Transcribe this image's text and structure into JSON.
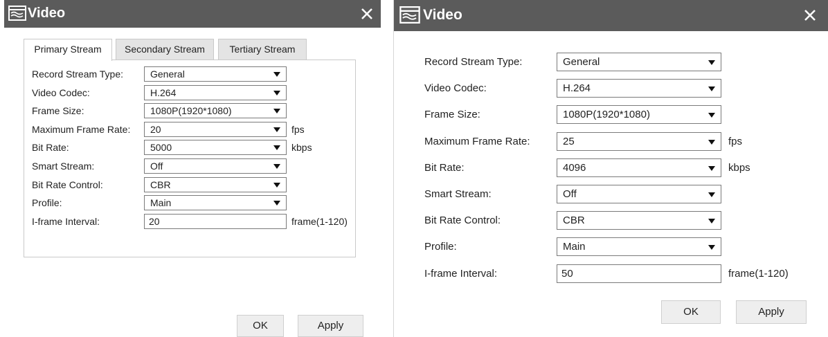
{
  "left_dialog": {
    "title": "Video",
    "tabs": [
      "Primary Stream",
      "Secondary Stream",
      "Tertiary Stream"
    ],
    "active_tab": "Primary Stream",
    "fields": [
      {
        "label": "Record Stream Type:",
        "value": "General",
        "kind": "select",
        "unit": ""
      },
      {
        "label": "Video Codec:",
        "value": "H.264",
        "kind": "select",
        "unit": ""
      },
      {
        "label": "Frame Size:",
        "value": "1080P(1920*1080)",
        "kind": "select",
        "unit": ""
      },
      {
        "label": "Maximum Frame Rate:",
        "value": "20",
        "kind": "select",
        "unit": "fps"
      },
      {
        "label": "Bit Rate:",
        "value": "5000",
        "kind": "select",
        "unit": "kbps"
      },
      {
        "label": "Smart Stream:",
        "value": "Off",
        "kind": "select",
        "unit": ""
      },
      {
        "label": "Bit Rate Control:",
        "value": "CBR",
        "kind": "select",
        "unit": ""
      },
      {
        "label": "Profile:",
        "value": "Main",
        "kind": "select",
        "unit": ""
      },
      {
        "label": "I-frame Interval:",
        "value": "20",
        "kind": "input",
        "unit": "frame(1-120)"
      }
    ],
    "ok_label": "OK",
    "apply_label": "Apply"
  },
  "right_dialog": {
    "title": "Video",
    "fields": [
      {
        "label": "Record Stream Type:",
        "value": "General",
        "kind": "select",
        "unit": ""
      },
      {
        "label": "Video Codec:",
        "value": "H.264",
        "kind": "select",
        "unit": ""
      },
      {
        "label": "Frame Size:",
        "value": "1080P(1920*1080)",
        "kind": "select",
        "unit": ""
      },
      {
        "label": "Maximum Frame Rate:",
        "value": "25",
        "kind": "select",
        "unit": "fps"
      },
      {
        "label": "Bit Rate:",
        "value": "4096",
        "kind": "select",
        "unit": "kbps"
      },
      {
        "label": "Smart Stream:",
        "value": "Off",
        "kind": "select",
        "unit": ""
      },
      {
        "label": "Bit Rate Control:",
        "value": "CBR",
        "kind": "select",
        "unit": ""
      },
      {
        "label": "Profile:",
        "value": "Main",
        "kind": "select",
        "unit": ""
      },
      {
        "label": "I-frame Interval:",
        "value": "50",
        "kind": "input",
        "unit": "frame(1-120)"
      }
    ],
    "ok_label": "OK",
    "apply_label": "Apply"
  },
  "colors": {
    "titlebar": "#5b5b5b",
    "tab_inactive": "#e4e4e4",
    "button": "#eeeeee"
  },
  "icons": {
    "title": "video-window-icon",
    "close": "close-icon",
    "dropdown": "dropdown-arrow-icon"
  }
}
